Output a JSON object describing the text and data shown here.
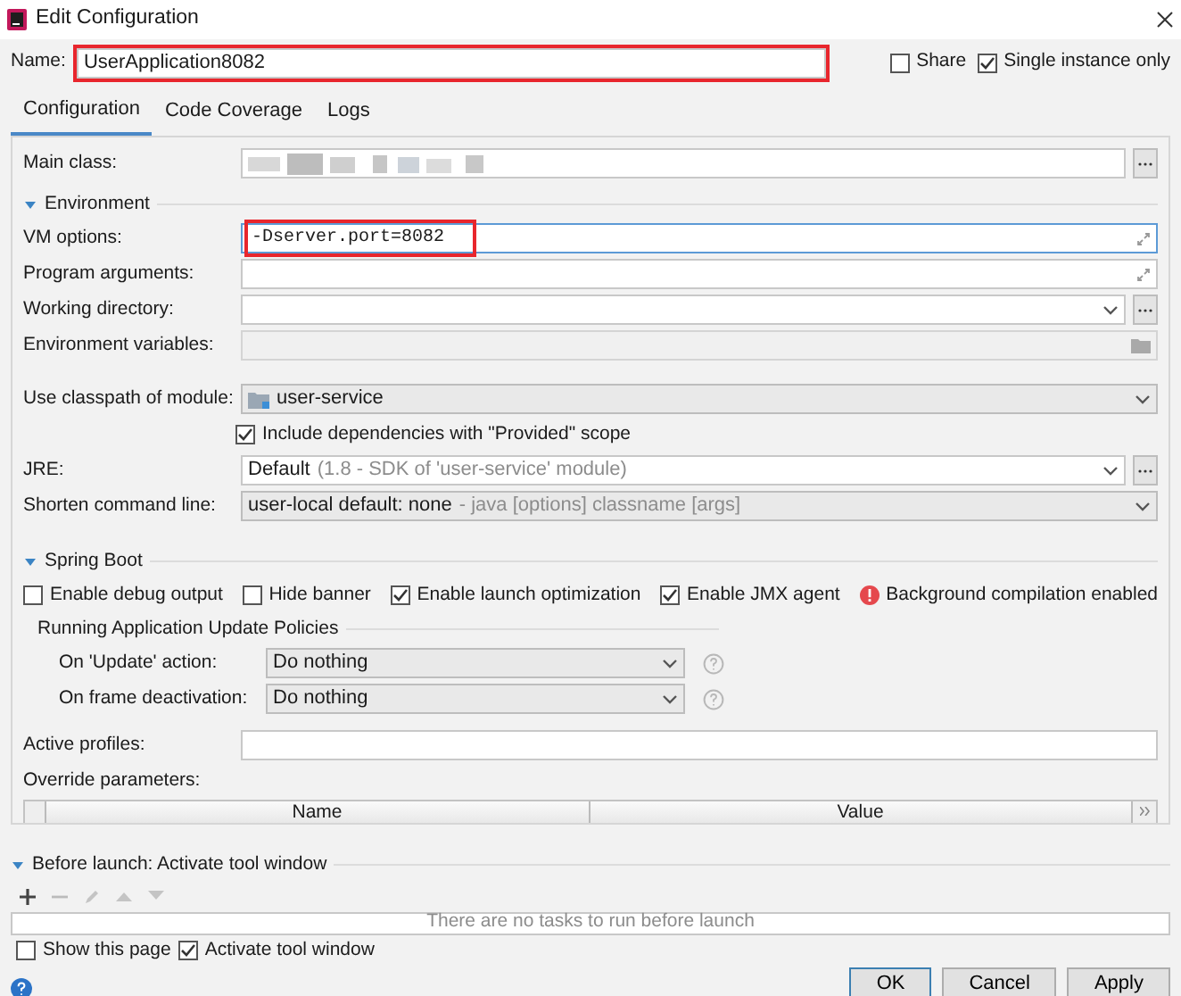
{
  "window": {
    "title": "Edit Configuration"
  },
  "name": {
    "label": "Name:",
    "value": "UserApplication8082",
    "highlighted": true
  },
  "share": {
    "label": "Share",
    "checked": false
  },
  "single_instance": {
    "label": "Single instance only",
    "checked": true
  },
  "tabs": [
    {
      "label": "Configuration",
      "selected": true
    },
    {
      "label": "Code Coverage",
      "selected": false
    },
    {
      "label": "Logs",
      "selected": false
    }
  ],
  "main_class": {
    "label": "Main class:"
  },
  "environment": {
    "title": "Environment",
    "expanded": true,
    "fields": [
      {
        "kind": "expand",
        "label": "VM options:",
        "value": "-Dserver.port=8082",
        "highlighted": true
      },
      {
        "kind": "expand",
        "label": "Program arguments:"
      },
      {
        "kind": "combo",
        "label": "Working directory:"
      },
      {
        "kind": "folder",
        "label": "Environment variables:"
      }
    ]
  },
  "classpath": {
    "label": "Use classpath of module:",
    "value": "user-service"
  },
  "include_provided": {
    "label": "Include dependencies with \"Provided\" scope",
    "checked": true
  },
  "jre": {
    "label": "JRE:",
    "value": "Default",
    "hint": "(1.8 - SDK of 'user-service' module)"
  },
  "shorten": {
    "label": "Shorten command line:",
    "value": "user-local default: none",
    "hint": "- java [options] classname [args]"
  },
  "spring_boot": {
    "title": "Spring Boot",
    "expanded": true,
    "options": [
      {
        "label": "Enable debug output",
        "checked": false
      },
      {
        "label": "Hide banner",
        "checked": false
      },
      {
        "label": "Enable launch optimization",
        "checked": true
      },
      {
        "label": "Enable JMX agent",
        "checked": true
      }
    ],
    "warning": "Background compilation enabled"
  },
  "update_policies": {
    "title": "Running Application Update Policies",
    "rows": [
      {
        "label": "On 'Update' action:",
        "value": "Do nothing"
      },
      {
        "label": "On frame deactivation:",
        "value": "Do nothing"
      }
    ]
  },
  "active_profiles": {
    "label": "Active profiles:"
  },
  "override": {
    "label": "Override parameters:",
    "columns": [
      "Name",
      "Value"
    ]
  },
  "before_launch": {
    "title": "Before launch: Activate tool window",
    "expanded": true,
    "empty_text": "There are no tasks to run before launch"
  },
  "show_page": {
    "label": "Show this page",
    "checked": false
  },
  "activate_tool_window": {
    "label": "Activate tool window",
    "checked": true
  },
  "buttons": [
    "OK",
    "Cancel",
    "Apply"
  ]
}
